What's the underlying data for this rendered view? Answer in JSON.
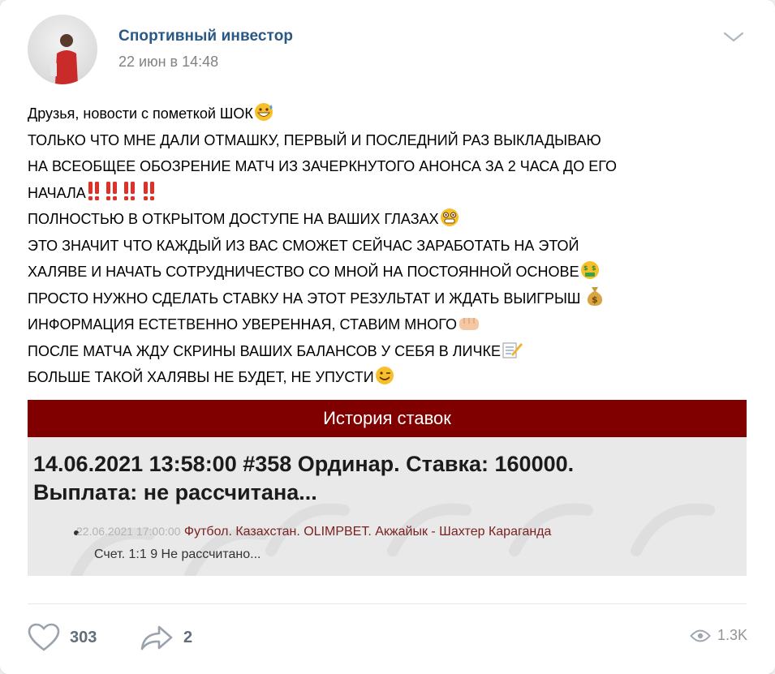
{
  "post": {
    "author": "Спортивный инвестор",
    "date": "22 июн в 14:48",
    "lines": [
      "Друзья, новости с пометкой ШОК",
      "ТОЛЬКО ЧТО МНЕ ДАЛИ ОТМАШКУ, ПЕРВЫЙ И ПОСЛЕДНИЙ РАЗ ВЫКЛАДЫВАЮ",
      "НА ВСЕОБЩЕЕ ОБОЗРЕНИЕ МАТЧ ИЗ ЗАЧЕРКНУТОГО АНОНСА ЗА 2 ЧАСА ДО ЕГО",
      "НАЧАЛА",
      "ПОЛНОСТЬЮ В ОТКРЫТОМ ДОСТУПЕ НА ВАШИХ ГЛАЗАХ",
      "ЭТО ЗНАЧИТ ЧТО КАЖДЫЙ ИЗ ВАС СМОЖЕТ СЕЙЧАС ЗАРАБОТАТЬ НА ЭТОЙ",
      "ХАЛЯВЕ И НАЧАТЬ СОТРУДНИЧЕСТВО СО МНОЙ НА ПОСТОЯННОЙ ОСНОВЕ",
      "ПРОСТО НУЖНО СДЕЛАТЬ СТАВКУ НА ЭТОТ РЕЗУЛЬТАТ И ЖДАТЬ ВЫИГРЫШ",
      "ИНФОРМАЦИЯ ЕСТЕТВЕННО УВЕРЕННАЯ, СТАВИМ МНОГО",
      "ПОСЛЕ МАТЧА ЖДУ СКРИНЫ ВАШИХ БАЛАНСОВ У СЕБЯ В ЛИЧКЕ",
      "БОЛЬШЕ ТАКОЙ ХАЛЯВЫ НЕ БУДЕТ, НЕ УПУСТИ"
    ]
  },
  "image": {
    "header": "История ставок",
    "title_line1": "14.06.2021 13:58:00 #358 Ординар. Ставка: 160000.",
    "title_line2": "Выплата: не рассчитана...",
    "bet_time": "22.06.2021 17:00:00",
    "bet_event": "Футбол. Казахстан. OLIMPBET. Акжайык - Шахтер Караганда",
    "bet_score": "Счет. 1:1 9 Не рассчитано..."
  },
  "footer": {
    "likes": "303",
    "shares": "2",
    "views": "1.3K"
  },
  "icons": {
    "like": "heart-icon",
    "share": "share-arrow-icon",
    "views": "eye-icon",
    "menu": "chevron-down-icon"
  },
  "colors": {
    "author_link": "#2a5885",
    "image_header": "#800000",
    "footer_text": "#626d7a"
  }
}
